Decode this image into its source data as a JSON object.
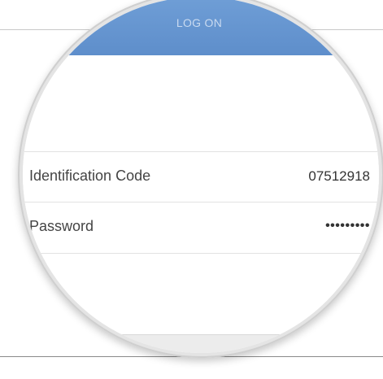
{
  "header": {
    "title": "LOG ON"
  },
  "form": {
    "fields": [
      {
        "label": "Identification Code",
        "value": "07512918"
      },
      {
        "label": "Password",
        "value": "•••••••••"
      }
    ]
  },
  "colors": {
    "header_blue": "#6f9ed6",
    "header_text": "#c9daf0",
    "label_text": "#444444",
    "divider": "#e2e2e2",
    "footer_gray": "#ececec"
  }
}
